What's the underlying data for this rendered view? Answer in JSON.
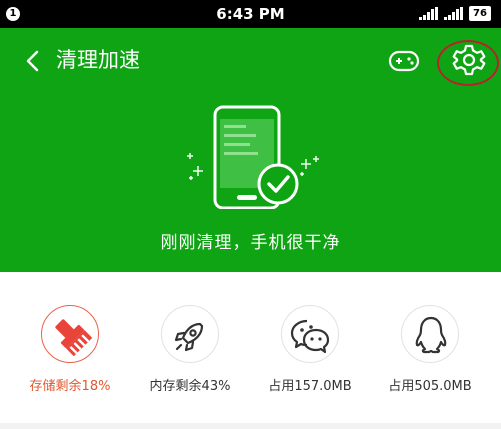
{
  "status_bar": {
    "notification_count": "1",
    "time": "6:43 PM",
    "battery": "76"
  },
  "header": {
    "title": "清理加速",
    "back_icon": "chevron-left-icon",
    "game_icon": "gamepad-icon",
    "settings_icon": "gear-icon"
  },
  "hero": {
    "illustration": "phone-checkmark-icon",
    "message": "刚刚清理，手机很干净"
  },
  "tools": [
    {
      "label": "存储剩余18%",
      "icon": "broom-icon",
      "active": true
    },
    {
      "label": "内存剩余43%",
      "icon": "rocket-icon",
      "active": false
    },
    {
      "label": "占用157.0MB",
      "icon": "wechat-icon",
      "active": false
    },
    {
      "label": "占用505.0MB",
      "icon": "qq-penguin-icon",
      "active": false
    }
  ],
  "colors": {
    "hero_green": "#0fa413",
    "active_orange": "#e2582f",
    "highlight_red": "#b4242a"
  }
}
